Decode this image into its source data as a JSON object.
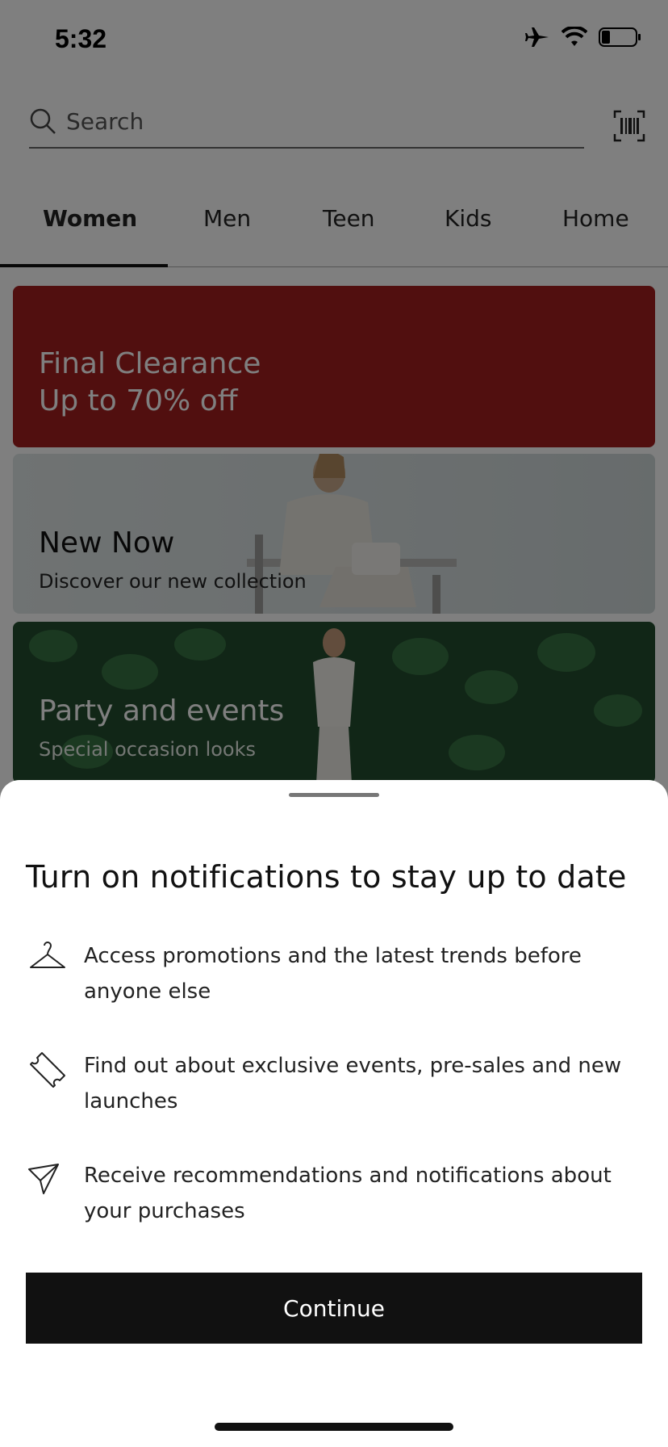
{
  "status_bar": {
    "time": "5:32",
    "icons": [
      "airplane-icon",
      "wifi-icon",
      "battery-icon"
    ]
  },
  "search": {
    "placeholder": "Search",
    "icons": [
      "search-icon",
      "barcode-icon"
    ]
  },
  "tabs": [
    {
      "label": "Women",
      "active": true
    },
    {
      "label": "Men",
      "active": false
    },
    {
      "label": "Teen",
      "active": false
    },
    {
      "label": "Kids",
      "active": false
    },
    {
      "label": "Home",
      "active": false
    }
  ],
  "banners": [
    {
      "title_line1": "Final Clearance",
      "title_line2": "Up to 70% off",
      "color": "#a31f1f"
    },
    {
      "title": "New Now",
      "subtitle": "Discover our new collection"
    },
    {
      "title": "Party and events",
      "subtitle": "Special occasion looks"
    }
  ],
  "sheet": {
    "title": "Turn on notifications to stay up to date",
    "benefits": [
      {
        "icon": "hanger-icon",
        "text": "Access promotions and the latest trends before anyone else"
      },
      {
        "icon": "ticket-icon",
        "text": "Find out about exclusive events, pre-sales and new launches"
      },
      {
        "icon": "paper-plane-icon",
        "text": "Receive recommendations and notifications about your purchases"
      }
    ],
    "continue_label": "Continue"
  },
  "colors": {
    "accent_black": "#111111",
    "clearance_red": "#a31f1f",
    "party_green": "#234d2e"
  }
}
